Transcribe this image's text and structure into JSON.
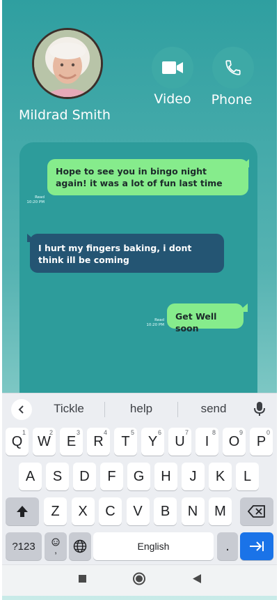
{
  "contact": {
    "name": "Mildrad Smith"
  },
  "actions": {
    "video_label": "Video",
    "phone_label": "Phone"
  },
  "messages": [
    {
      "direction": "out",
      "text": "Hope to see you in bingo night again! it was a lot of fun last time",
      "status": "Read",
      "time": "10:20 PM"
    },
    {
      "direction": "in",
      "text": "I hurt my fingers baking, i dont think ill be coming"
    },
    {
      "direction": "out",
      "text": "Get Well soon",
      "status": "Read",
      "time": "10:20 PM"
    }
  ],
  "keyboard": {
    "suggestions": [
      "Tickle",
      "help",
      "send"
    ],
    "row1": [
      {
        "key": "Q",
        "num": "1"
      },
      {
        "key": "W",
        "num": "2"
      },
      {
        "key": "E",
        "num": "3"
      },
      {
        "key": "R",
        "num": "4"
      },
      {
        "key": "T",
        "num": "5"
      },
      {
        "key": "Y",
        "num": "6"
      },
      {
        "key": "U",
        "num": "7"
      },
      {
        "key": "I",
        "num": "8"
      },
      {
        "key": "O",
        "num": "9"
      },
      {
        "key": "P",
        "num": "0"
      }
    ],
    "row2": [
      "A",
      "S",
      "D",
      "F",
      "G",
      "H",
      "J",
      "K",
      "L"
    ],
    "row3": [
      "Z",
      "X",
      "C",
      "V",
      "B",
      "N",
      "M"
    ],
    "symbols_label": "?123",
    "emoji_comma": ",",
    "space_label": "English",
    "period": "."
  },
  "colors": {
    "accent_green": "#86ec8c",
    "incoming_blue": "#245573",
    "teal": "#2f9fa0",
    "enter_blue": "#1a73e8"
  }
}
